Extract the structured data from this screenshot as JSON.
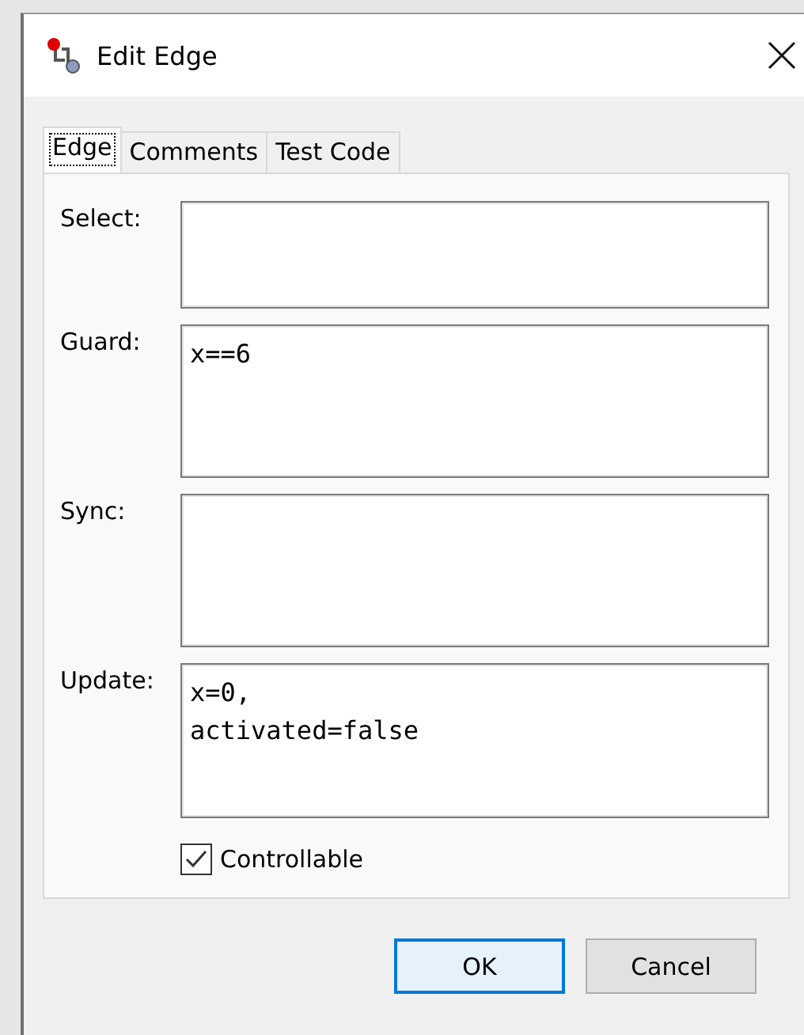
{
  "window": {
    "title": "Edit Edge"
  },
  "tabs": [
    {
      "label": "Edge",
      "selected": true
    },
    {
      "label": "Comments",
      "selected": false
    },
    {
      "label": "Test Code",
      "selected": false
    }
  ],
  "fields": [
    {
      "label": "Select:"
    },
    {
      "label": "Guard:",
      "value": "x==6"
    },
    {
      "label": "Sync:"
    },
    {
      "label": "Update:",
      "value": "x=0,\nactivated=false"
    }
  ],
  "controllable": {
    "label": "Controllable",
    "checked": true
  },
  "buttons": [
    {
      "label": "OK",
      "default": true
    },
    {
      "label": "Cancel",
      "default": false
    }
  ]
}
